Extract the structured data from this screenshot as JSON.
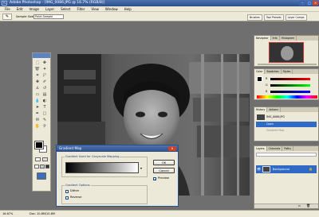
{
  "app": {
    "logo_text": "Ps",
    "title": "Adobe Photoshop - [IMG_0086.JPG @ 16.7% (RGB/8)]"
  },
  "menu": [
    "File",
    "Edit",
    "Image",
    "Layer",
    "Select",
    "Filter",
    "View",
    "Window",
    "Help"
  ],
  "options_bar": {
    "sample_label": "Sample Size:",
    "sample_value": "Point Sample",
    "well_tabs": [
      "Brushes",
      "Tool Presets",
      "Layer Comps"
    ]
  },
  "panels": {
    "navigator": {
      "tabs": [
        "Navigator",
        "Info",
        "Histogram"
      ]
    },
    "color": {
      "tabs": [
        "Color",
        "Swatches",
        "Styles"
      ],
      "channels": [
        "R",
        "G",
        "B"
      ]
    },
    "history": {
      "tabs": [
        "History",
        "Actions"
      ],
      "items": [
        "IMG_0086.JPG",
        "Open",
        "Gradient Map"
      ]
    },
    "layers": {
      "tabs": [
        "Layers",
        "Channels",
        "Paths"
      ],
      "layer_name": "Background"
    }
  },
  "dialog": {
    "title": "Gradient Map",
    "close_symbol": "x",
    "group1_label": "Gradient Used for Grayscale Mapping",
    "group2_label": "Gradient Options",
    "options": [
      "Dither",
      "Reverse"
    ],
    "ok": "OK",
    "cancel": "Cancel",
    "preview": "Preview",
    "preview_checked": true
  },
  "status": {
    "zoom": "16.67%",
    "doc": "Doc: 10.8M/10.8M"
  },
  "colors": {
    "accent": "#2e4f88",
    "selected": "#316ac5",
    "close": "#c8442a"
  }
}
